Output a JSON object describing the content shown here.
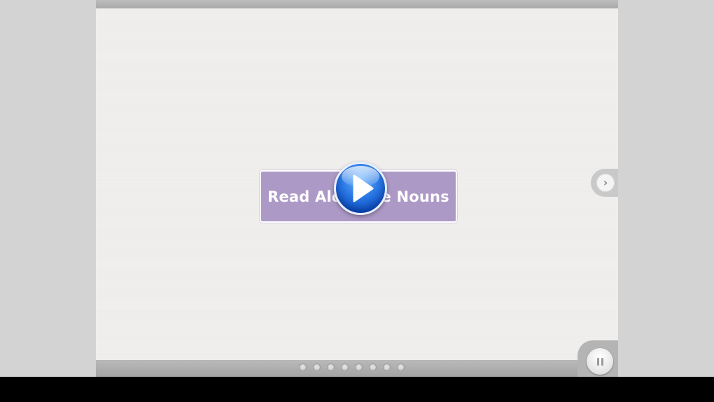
{
  "slide": {
    "title": "Read Aloud: The Nouns",
    "title_visible_left": "Read Alo",
    "title_visible_right": "e Nouns"
  },
  "controls": {
    "play_icon": "play-icon",
    "next_icon": "chevron-right-icon",
    "pause_icon": "pause-icon",
    "next_glyph": "›"
  },
  "pagination": {
    "total_pages": 8,
    "dots": [
      "page-1",
      "page-2",
      "page-3",
      "page-4",
      "page-5",
      "page-6",
      "page-7",
      "page-8"
    ]
  },
  "colors": {
    "title_card": "#ad99c6",
    "slide_background": "#f0efed",
    "play_button": "#2a78e4",
    "frame": "#b7b7b7"
  }
}
